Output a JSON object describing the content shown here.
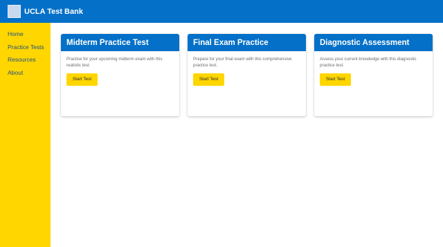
{
  "header": {
    "title": "UCLA Test Bank"
  },
  "sidebar": {
    "items": [
      {
        "label": "Home"
      },
      {
        "label": "Practice Tests"
      },
      {
        "label": "Resources"
      },
      {
        "label": "About"
      }
    ]
  },
  "cards": [
    {
      "title": "Midterm Practice Test",
      "description": "Practice for your upcoming midterm exam with this realistic test.",
      "button": "Start Test"
    },
    {
      "title": "Final Exam Practice",
      "description": "Prepare for your final exam with this comprehensive practice test.",
      "button": "Start Test"
    },
    {
      "title": "Diagnostic Assessment",
      "description": "Assess your current knowledge with this diagnostic practice test.",
      "button": "Start Test"
    }
  ],
  "colors": {
    "primary": "#0470c8",
    "accent": "#ffd600",
    "nav_text": "#1d4f86"
  }
}
